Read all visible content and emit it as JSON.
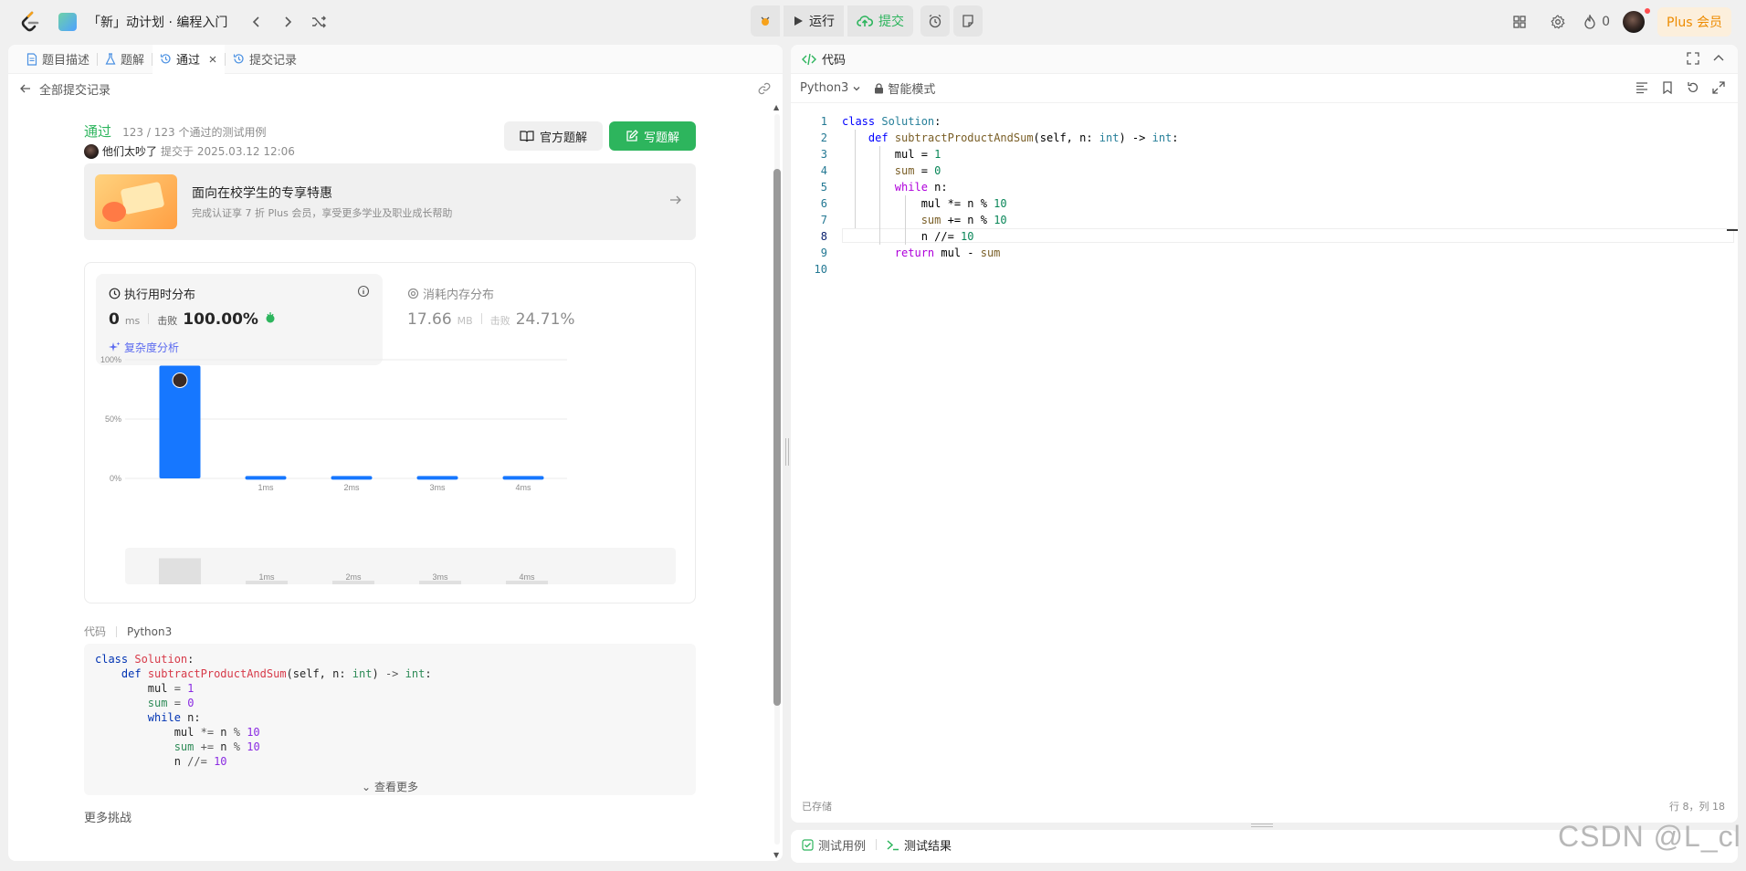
{
  "topbar": {
    "app_title": "「新」动计划 · 编程入门",
    "run_label": "运行",
    "submit_label": "提交",
    "streak_count": "0",
    "plus_label": "Plus 会员"
  },
  "left_tabs": [
    {
      "label": "题目描述"
    },
    {
      "label": "题解"
    },
    {
      "label": "通过"
    },
    {
      "label": "提交记录"
    }
  ],
  "back_link": "全部提交记录",
  "submission": {
    "status": "通过",
    "passed": "123 / 123 个通过的测试用例",
    "author": "他们太吵了",
    "submitted_at": "提交于 2025.03.12 12:06",
    "official_solution_label": "官方题解",
    "write_solution_label": "写题解"
  },
  "promo": {
    "title": "面向在校学生的专享特惠",
    "subtitle": "完成认证享 7 折 Plus 会员，享受更多学业及职业成长帮助"
  },
  "runtime": {
    "title": "执行用时分布",
    "value": "0",
    "unit": "ms",
    "beat_label": "击败",
    "beat_value": "100.00%",
    "analysis_label": "复杂度分析"
  },
  "memory": {
    "title": "消耗内存分布",
    "value": "17.66",
    "unit": "MB",
    "beat_label": "击败",
    "beat_value": "24.71%"
  },
  "chart_data": {
    "type": "bar",
    "categories": [
      "0ms",
      "1ms",
      "2ms",
      "3ms",
      "4ms"
    ],
    "tick_labels": [
      "",
      "1ms",
      "2ms",
      "3ms",
      "4ms"
    ],
    "values": [
      95,
      2,
      2,
      2,
      2
    ],
    "ylim": [
      0,
      100
    ],
    "yticks": [
      "0%",
      "50%",
      "100%"
    ],
    "grid": true,
    "bar_color": "#1677ff",
    "highlight_index": 0
  },
  "code_section": {
    "label": "代码",
    "lang": "Python3",
    "lines": [
      "class Solution:",
      "    def subtractProductAndSum(self, n: int) -> int:",
      "        mul = 1",
      "        sum = 0",
      "        while n:",
      "            mul *= n % 10",
      "            sum += n % 10",
      "            n //= 10"
    ],
    "more_label": "查看更多"
  },
  "more_challenges": "更多挑战",
  "editor": {
    "title": "代码",
    "language": "Python3",
    "mode": "智能模式",
    "line_numbers": [
      "1",
      "2",
      "3",
      "4",
      "5",
      "6",
      "7",
      "8",
      "9",
      "10"
    ],
    "saved_label": "已存储",
    "position": "行 8，列 18"
  },
  "bottom_tabs": {
    "testcase": "测试用例",
    "result": "测试结果"
  },
  "watermark": "CSDN @L_cl",
  "colors": {
    "accent_green": "#2db55d",
    "bar_blue": "#1677ff",
    "plus_orange": "#ed8b00"
  }
}
